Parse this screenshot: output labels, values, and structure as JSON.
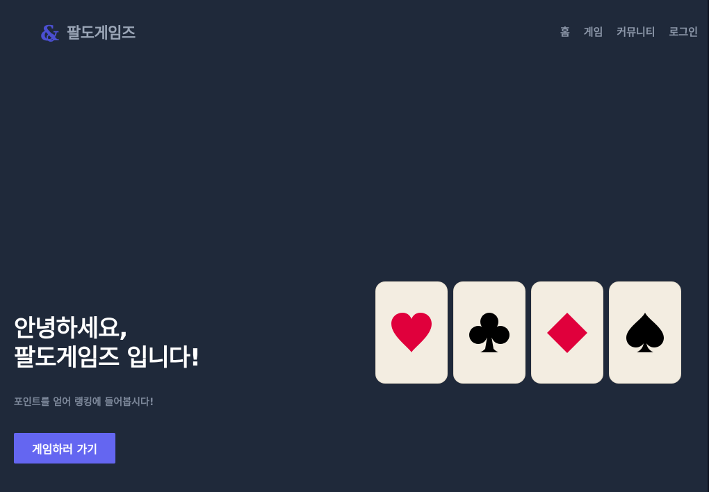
{
  "brand": {
    "name": "팔도게임즈",
    "icon": "ampersand-logo-icon"
  },
  "nav": {
    "items": [
      {
        "label": "홈"
      },
      {
        "label": "게임"
      },
      {
        "label": "커뮤니티"
      },
      {
        "label": "로그인"
      }
    ]
  },
  "hero": {
    "title_line1": "안녕하세요,",
    "title_line2": "팔도게임즈 입니다!",
    "subtitle": "포인트를 얻어 랭킹에 들어봅시다!",
    "cta_label": "게임하러 가기"
  },
  "cards": [
    {
      "suit": "heart-icon",
      "color": "#e0003c"
    },
    {
      "suit": "club-icon",
      "color": "#000000"
    },
    {
      "suit": "diamond-icon",
      "color": "#e0003c"
    },
    {
      "suit": "spade-icon",
      "color": "#000000"
    }
  ],
  "colors": {
    "background": "#1f293a",
    "accent": "#6466f1",
    "card_face": "#f3ede1",
    "nav_text": "#8c97a9"
  }
}
